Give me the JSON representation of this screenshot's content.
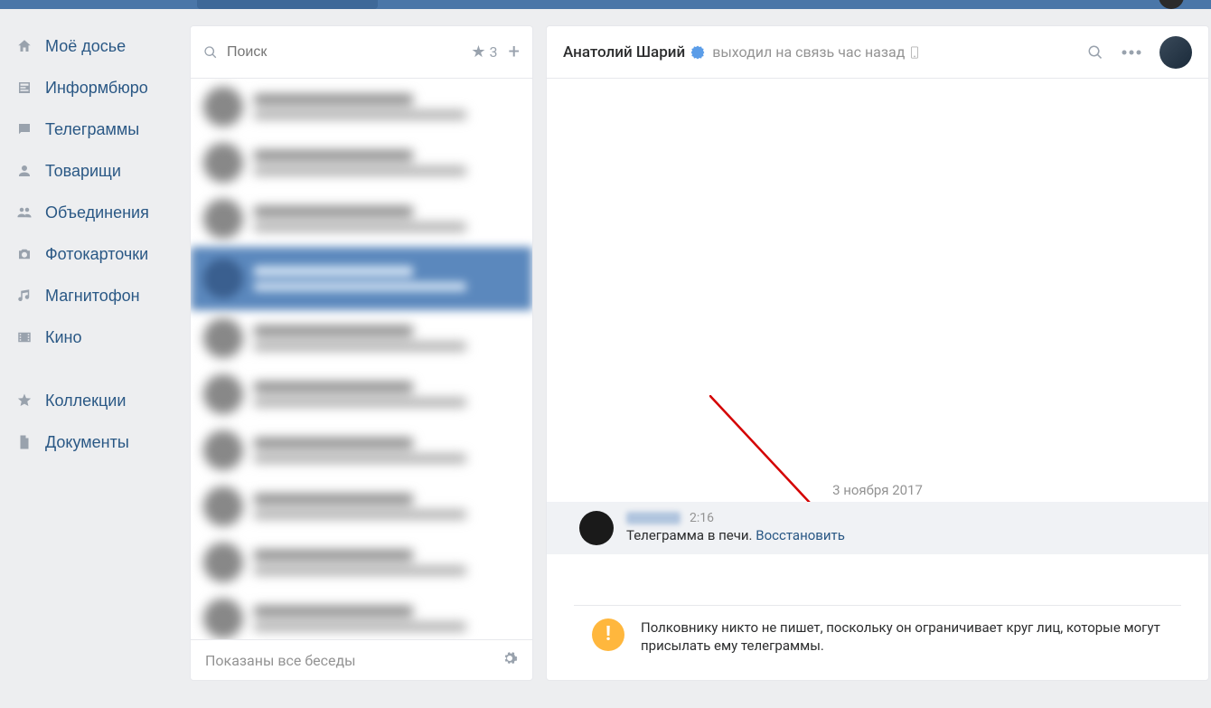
{
  "sidebar": {
    "items": [
      {
        "label": "Моё досье",
        "icon": "home-icon"
      },
      {
        "label": "Информбюро",
        "icon": "news-icon"
      },
      {
        "label": "Телеграммы",
        "icon": "chat-icon"
      },
      {
        "label": "Товарищи",
        "icon": "friends-icon"
      },
      {
        "label": "Объединения",
        "icon": "groups-icon"
      },
      {
        "label": "Фотокарточки",
        "icon": "camera-icon"
      },
      {
        "label": "Магнитофон",
        "icon": "music-icon"
      },
      {
        "label": "Кино",
        "icon": "video-icon"
      }
    ],
    "items2": [
      {
        "label": "Коллекции",
        "icon": "star-icon"
      },
      {
        "label": "Документы",
        "icon": "document-icon"
      }
    ]
  },
  "conversations": {
    "search_placeholder": "Поиск",
    "starred_count": "3",
    "footer_text": "Показаны все беседы"
  },
  "chat": {
    "name": "Анатолий Шарий",
    "status": "выходил на связь час назад",
    "date": "3 ноября 2017",
    "message": {
      "time": "2:16",
      "text": "Телеграмма в печи. ",
      "restore": "Восстановить"
    },
    "warning": "Полковнику никто не пишет, поскольку он ограничивает круг лиц, которые могут присылать ему телеграммы."
  }
}
